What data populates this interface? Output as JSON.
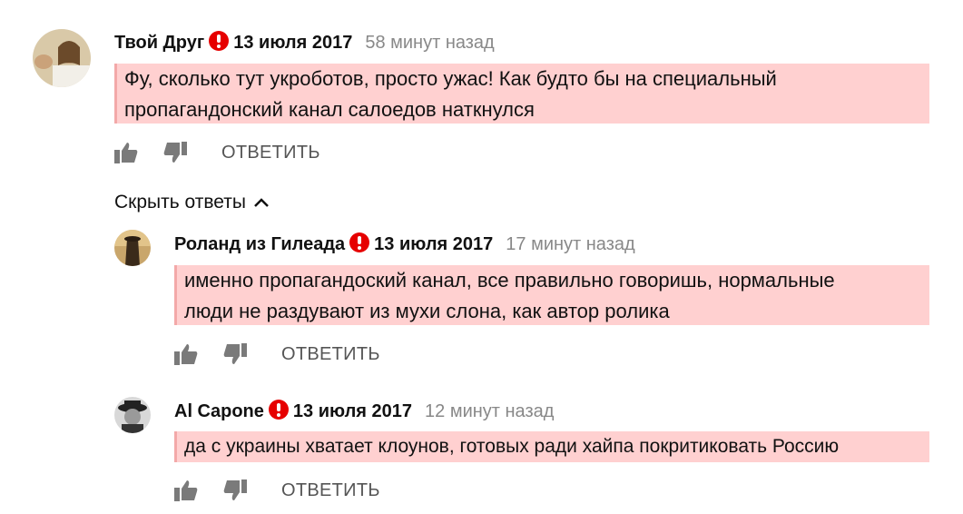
{
  "comments": [
    {
      "author": "Твой Друг",
      "date": "13 июля 2017",
      "ago": "58 минут назад",
      "text_line1": "Фу, сколько тут укроботов, просто ужас! Как будто бы на специальный",
      "text_line2": "пропагандонский канал салоедов наткнулся",
      "reply": "ОТВЕТИТЬ"
    },
    {
      "author": "Роланд из Гилеада",
      "date": "13 июля 2017",
      "ago": "17 минут назад",
      "text_line1": "именно пропагандоский канал, все правильно говоришь, нормальные",
      "text_line2": "люди не раздувают из мухи слона, как автор ролика",
      "reply": "ОТВЕТИТЬ"
    },
    {
      "author": "Al Capone",
      "date": "13 июля 2017",
      "ago": "12 минут назад",
      "text_line1": "да с украины хватает клоунов, готовых ради хайпа покритиковать Россию",
      "reply": "ОТВЕТИТЬ"
    }
  ],
  "hide_replies": "Скрыть ответы",
  "colors": {
    "highlight": "#ffd0d0",
    "warning": "#e60000",
    "muted": "#888888"
  }
}
